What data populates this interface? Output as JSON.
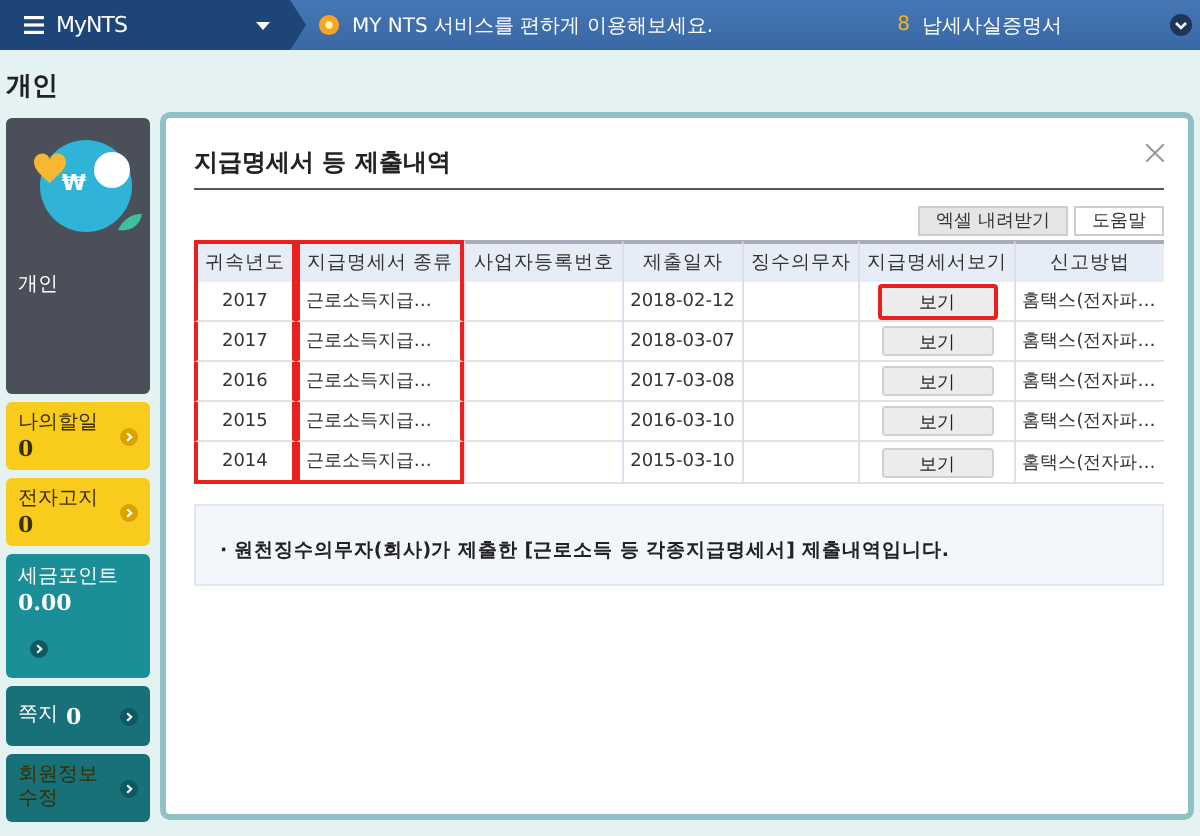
{
  "header": {
    "logo": "MyNTS",
    "notice": "MY NTS 서비스를 편하게 이용해보세요.",
    "count": "8",
    "link": "납세사실증명서"
  },
  "page_title": "개인",
  "profile": {
    "symbol": "₩",
    "label": "개인"
  },
  "sidebar_cards": [
    {
      "kind": "stacked",
      "label": "나의할일",
      "value": "0",
      "color": "#f9cb1c"
    },
    {
      "kind": "stacked",
      "label": "전자고지",
      "value": "0",
      "color": "#f9cb1c"
    },
    {
      "kind": "tall",
      "label": "세금포인트",
      "value": "0.00",
      "color": "#1b8f98"
    },
    {
      "kind": "inline",
      "label": "쪽지",
      "value": "0",
      "color": "#187079"
    },
    {
      "kind": "stacked",
      "label": "회원정보\n수정",
      "color": "#187079"
    }
  ],
  "dialog": {
    "title": "지급명세서 등 제출내역",
    "toolbar": [
      "엑셀 내려받기",
      "도움말"
    ],
    "columns": [
      {
        "label": "귀속년도",
        "highlighted": true
      },
      {
        "label": "지급명세서 종류",
        "highlighted": true
      },
      {
        "label": "사업자등록번호",
        "highlighted": false
      },
      {
        "label": "제출일자",
        "highlighted": false
      },
      {
        "label": "징수의무자",
        "highlighted": false
      },
      {
        "label": "지급명세서보기",
        "highlighted": false
      },
      {
        "label": "신고방법",
        "highlighted": false
      }
    ],
    "rows": [
      {
        "year": "2017",
        "type": "근로소득지급…",
        "date": "2018-02-12",
        "view_button": {
          "label": "보기",
          "highlighted": true
        },
        "method": "홈택스(전자파…"
      },
      {
        "year": "2017",
        "type": "근로소득지급…",
        "date": "2018-03-07",
        "view_button": {
          "label": "보기",
          "highlighted": false
        },
        "method": "홈택스(전자파…"
      },
      {
        "year": "2016",
        "type": "근로소득지급…",
        "date": "2017-03-08",
        "view_button": {
          "label": "보기",
          "highlighted": false
        },
        "method": "홈택스(전자파…"
      },
      {
        "year": "2015",
        "type": "근로소득지급…",
        "date": "2016-03-10",
        "view_button": {
          "label": "보기",
          "highlighted": false
        },
        "method": "홈택스(전자파…"
      },
      {
        "year": "2014",
        "type": "근로소득지급…",
        "date": "2015-03-10",
        "view_button": {
          "label": "보기",
          "highlighted": false
        },
        "method": "홈택스(전자파…"
      }
    ],
    "note": "· 원천징수의무자(회사)가 제출한 [근로소득 등 각종지급명세서] 제출내역입니다."
  }
}
